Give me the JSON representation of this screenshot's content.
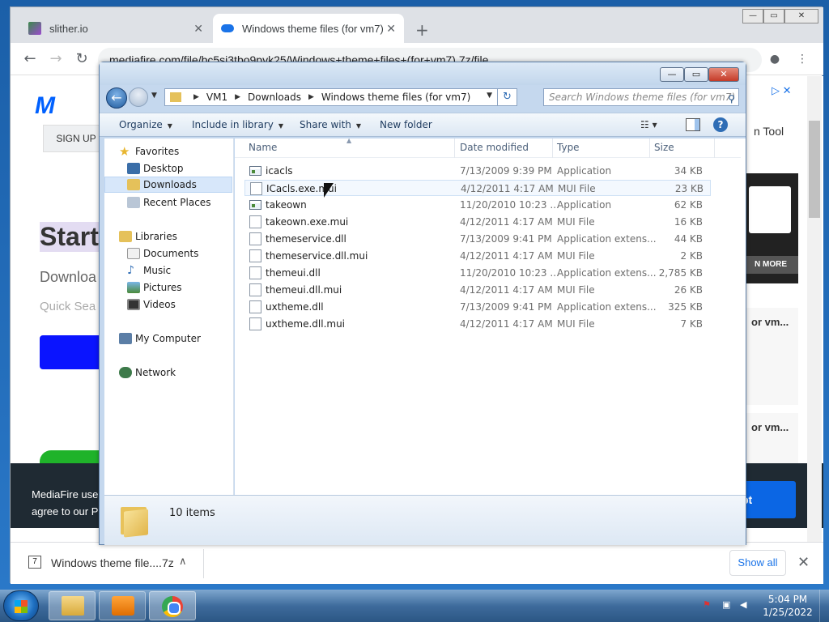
{
  "chrome": {
    "tabs": [
      {
        "title": "slither.io",
        "close": "✕"
      },
      {
        "title": "Windows theme files (for vm7)",
        "close": "✕"
      }
    ],
    "new_tab": "+",
    "url": "mediafire.com/file/bc5si3tbo9pyk25/Windows+theme+files+(for+vm7).7z/file",
    "window_controls": [
      "—",
      "▭",
      "✕"
    ]
  },
  "page": {
    "logo": "M",
    "signup": "SIGN UP",
    "start": "Start",
    "download": "Downloa",
    "quick": "Quick Sea",
    "tool": "n Tool",
    "learn_more": "N MORE",
    "side1": "or vm...",
    "side2": "or vm...",
    "cookie_line1": "MediaFire use",
    "cookie_line2": "agree to our P",
    "accept": "pt"
  },
  "shelf": {
    "file": "Windows theme file....7z",
    "show_all": "Show all"
  },
  "explorer": {
    "breadcrumb": [
      "VM1",
      "Downloads",
      "Windows theme files (for vm7)"
    ],
    "search_placeholder": "Search Windows theme files (for vm7)",
    "commands": {
      "organize": "Organize",
      "include": "Include in library",
      "share": "Share with",
      "new_folder": "New folder"
    },
    "nav": {
      "favorites": "Favorites",
      "desktop": "Desktop",
      "downloads": "Downloads",
      "recent": "Recent Places",
      "libraries": "Libraries",
      "documents": "Documents",
      "music": "Music",
      "pictures": "Pictures",
      "videos": "Videos",
      "computer": "My Computer",
      "network": "Network"
    },
    "columns": {
      "name": "Name",
      "date": "Date modified",
      "type": "Type",
      "size": "Size"
    },
    "files": [
      {
        "name": "icacls",
        "date": "7/13/2009 9:39 PM",
        "type": "Application",
        "size": "34 KB",
        "icon": "application-icon"
      },
      {
        "name": "ICacls.exe.mui",
        "date": "4/12/2011 4:17 AM",
        "type": "MUI File",
        "size": "23 KB",
        "icon": "file-icon"
      },
      {
        "name": "takeown",
        "date": "11/20/2010 10:23 ...",
        "type": "Application",
        "size": "62 KB",
        "icon": "application-icon"
      },
      {
        "name": "takeown.exe.mui",
        "date": "4/12/2011 4:17 AM",
        "type": "MUI File",
        "size": "16 KB",
        "icon": "file-icon"
      },
      {
        "name": "themeservice.dll",
        "date": "7/13/2009 9:41 PM",
        "type": "Application extens...",
        "size": "44 KB",
        "icon": "file-icon"
      },
      {
        "name": "themeservice.dll.mui",
        "date": "4/12/2011 4:17 AM",
        "type": "MUI File",
        "size": "2 KB",
        "icon": "file-icon"
      },
      {
        "name": "themeui.dll",
        "date": "11/20/2010 10:23 ...",
        "type": "Application extens...",
        "size": "2,785 KB",
        "icon": "file-icon"
      },
      {
        "name": "themeui.dll.mui",
        "date": "4/12/2011 4:17 AM",
        "type": "MUI File",
        "size": "26 KB",
        "icon": "file-icon"
      },
      {
        "name": "uxtheme.dll",
        "date": "7/13/2009 9:41 PM",
        "type": "Application extens...",
        "size": "325 KB",
        "icon": "file-icon"
      },
      {
        "name": "uxtheme.dll.mui",
        "date": "4/12/2011 4:17 AM",
        "type": "MUI File",
        "size": "7 KB",
        "icon": "file-icon"
      }
    ],
    "item_count": "10 items"
  },
  "taskbar": {
    "time": "5:04 PM",
    "date": "1/25/2022"
  }
}
